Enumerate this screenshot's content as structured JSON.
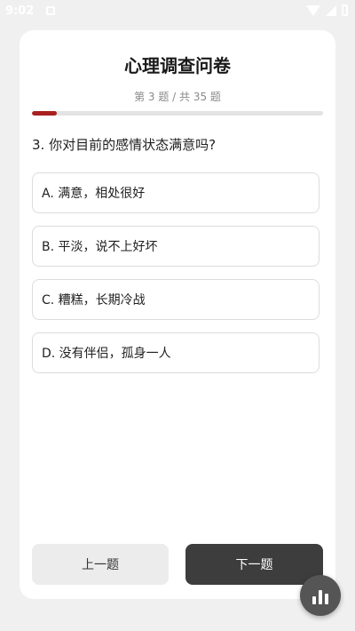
{
  "status_bar": {
    "time": "9:02"
  },
  "survey": {
    "title": "心理调查问卷",
    "progress_label": "第 3 题 / 共 35 题",
    "progress_fraction": 0.0857,
    "accent_color": "#a8201f"
  },
  "question": {
    "text": "3. 你对目前的感情状态满意吗?",
    "options": [
      {
        "label": "A. 满意，相处很好"
      },
      {
        "label": "B. 平淡，说不上好坏"
      },
      {
        "label": "C. 糟糕，长期冷战"
      },
      {
        "label": "D. 没有伴侣，孤身一人"
      }
    ]
  },
  "nav": {
    "prev_label": "上一题",
    "next_label": "下一题"
  },
  "fab": {
    "icon": "bar-chart-icon"
  }
}
